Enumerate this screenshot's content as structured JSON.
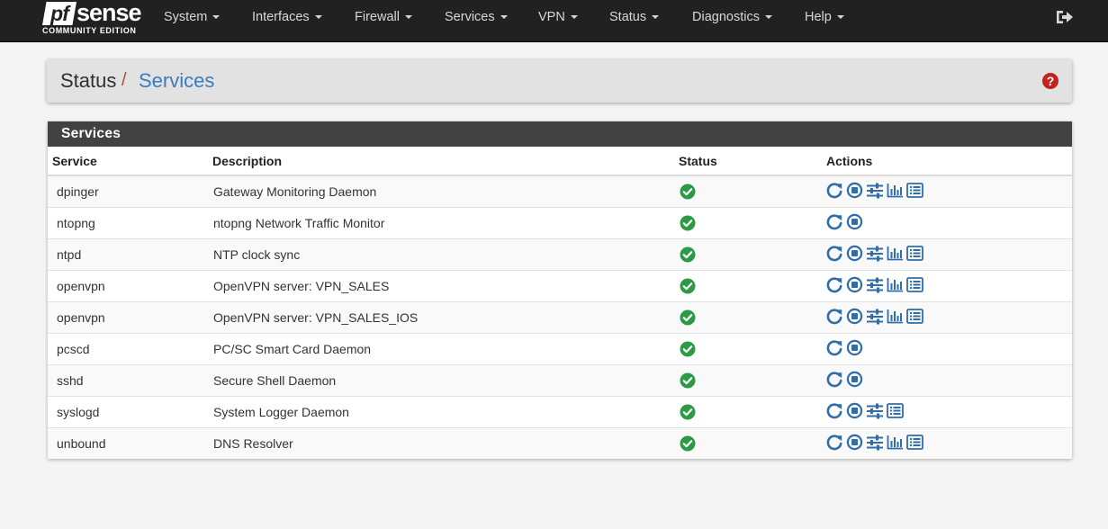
{
  "brand": {
    "logo_pf": "pf",
    "logo_sense": "sense",
    "edition": "COMMUNITY EDITION"
  },
  "nav": {
    "items": [
      {
        "label": "System"
      },
      {
        "label": "Interfaces"
      },
      {
        "label": "Firewall"
      },
      {
        "label": "Services"
      },
      {
        "label": "VPN"
      },
      {
        "label": "Status"
      },
      {
        "label": "Diagnostics"
      },
      {
        "label": "Help"
      }
    ]
  },
  "breadcrumb": {
    "parent": "Status",
    "separator": "/",
    "current": "Services"
  },
  "help": {
    "glyph": "?"
  },
  "panel": {
    "title": "Services",
    "columns": [
      "Service",
      "Description",
      "Status",
      "Actions"
    ]
  },
  "rows": [
    {
      "service": "dpinger",
      "description": "Gateway Monitoring Daemon"
    },
    {
      "service": "ntopng",
      "description": "ntopng Network Traffic Monitor"
    },
    {
      "service": "ntpd",
      "description": "NTP clock sync"
    },
    {
      "service": "openvpn",
      "description": "OpenVPN server: VPN_SALES"
    },
    {
      "service": "openvpn",
      "description": "OpenVPN server: VPN_SALES_IOS"
    },
    {
      "service": "pcscd",
      "description": "PC/SC Smart Card Daemon"
    },
    {
      "service": "sshd",
      "description": "Secure Shell Daemon"
    },
    {
      "service": "syslogd",
      "description": "System Logger Daemon"
    },
    {
      "service": "unbound",
      "description": "DNS Resolver"
    }
  ],
  "row_icons": [
    [
      "restart-icon",
      "stop-icon",
      "settings-icon",
      "status-graph-icon",
      "logs-icon"
    ],
    [
      "restart-icon",
      "stop-icon"
    ],
    [
      "restart-icon",
      "stop-icon",
      "settings-icon",
      "status-graph-icon",
      "logs-icon"
    ],
    [
      "restart-icon",
      "stop-icon",
      "settings-icon",
      "status-graph-icon",
      "logs-icon"
    ],
    [
      "restart-icon",
      "stop-icon",
      "settings-icon",
      "status-graph-icon",
      "logs-icon"
    ],
    [
      "restart-icon",
      "stop-icon"
    ],
    [
      "restart-icon",
      "stop-icon"
    ],
    [
      "restart-icon",
      "stop-icon",
      "settings-icon",
      "logs-icon"
    ],
    [
      "restart-icon",
      "stop-icon",
      "settings-icon",
      "status-graph-icon",
      "logs-icon"
    ]
  ],
  "colors": {
    "navbar": "#212121",
    "panel_heading": "#424242",
    "link_blue": "#3b7bbf",
    "status_ok": "#2d9a45",
    "help_red": "#c0241c",
    "icon_blue": "#2f6ea8"
  }
}
